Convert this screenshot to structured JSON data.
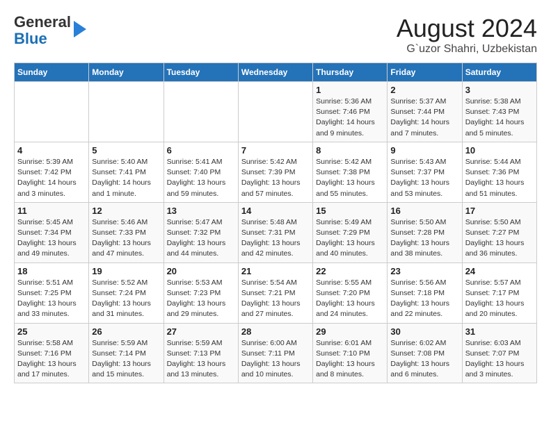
{
  "header": {
    "logo_line1": "General",
    "logo_line2": "Blue",
    "title": "August 2024",
    "subtitle": "G`uzor Shahri, Uzbekistan"
  },
  "days_of_week": [
    "Sunday",
    "Monday",
    "Tuesday",
    "Wednesday",
    "Thursday",
    "Friday",
    "Saturday"
  ],
  "weeks": [
    [
      {
        "day": "",
        "info": ""
      },
      {
        "day": "",
        "info": ""
      },
      {
        "day": "",
        "info": ""
      },
      {
        "day": "",
        "info": ""
      },
      {
        "day": "1",
        "info": "Sunrise: 5:36 AM\nSunset: 7:46 PM\nDaylight: 14 hours\nand 9 minutes."
      },
      {
        "day": "2",
        "info": "Sunrise: 5:37 AM\nSunset: 7:44 PM\nDaylight: 14 hours\nand 7 minutes."
      },
      {
        "day": "3",
        "info": "Sunrise: 5:38 AM\nSunset: 7:43 PM\nDaylight: 14 hours\nand 5 minutes."
      }
    ],
    [
      {
        "day": "4",
        "info": "Sunrise: 5:39 AM\nSunset: 7:42 PM\nDaylight: 14 hours\nand 3 minutes."
      },
      {
        "day": "5",
        "info": "Sunrise: 5:40 AM\nSunset: 7:41 PM\nDaylight: 14 hours\nand 1 minute."
      },
      {
        "day": "6",
        "info": "Sunrise: 5:41 AM\nSunset: 7:40 PM\nDaylight: 13 hours\nand 59 minutes."
      },
      {
        "day": "7",
        "info": "Sunrise: 5:42 AM\nSunset: 7:39 PM\nDaylight: 13 hours\nand 57 minutes."
      },
      {
        "day": "8",
        "info": "Sunrise: 5:42 AM\nSunset: 7:38 PM\nDaylight: 13 hours\nand 55 minutes."
      },
      {
        "day": "9",
        "info": "Sunrise: 5:43 AM\nSunset: 7:37 PM\nDaylight: 13 hours\nand 53 minutes."
      },
      {
        "day": "10",
        "info": "Sunrise: 5:44 AM\nSunset: 7:36 PM\nDaylight: 13 hours\nand 51 minutes."
      }
    ],
    [
      {
        "day": "11",
        "info": "Sunrise: 5:45 AM\nSunset: 7:34 PM\nDaylight: 13 hours\nand 49 minutes."
      },
      {
        "day": "12",
        "info": "Sunrise: 5:46 AM\nSunset: 7:33 PM\nDaylight: 13 hours\nand 47 minutes."
      },
      {
        "day": "13",
        "info": "Sunrise: 5:47 AM\nSunset: 7:32 PM\nDaylight: 13 hours\nand 44 minutes."
      },
      {
        "day": "14",
        "info": "Sunrise: 5:48 AM\nSunset: 7:31 PM\nDaylight: 13 hours\nand 42 minutes."
      },
      {
        "day": "15",
        "info": "Sunrise: 5:49 AM\nSunset: 7:29 PM\nDaylight: 13 hours\nand 40 minutes."
      },
      {
        "day": "16",
        "info": "Sunrise: 5:50 AM\nSunset: 7:28 PM\nDaylight: 13 hours\nand 38 minutes."
      },
      {
        "day": "17",
        "info": "Sunrise: 5:50 AM\nSunset: 7:27 PM\nDaylight: 13 hours\nand 36 minutes."
      }
    ],
    [
      {
        "day": "18",
        "info": "Sunrise: 5:51 AM\nSunset: 7:25 PM\nDaylight: 13 hours\nand 33 minutes."
      },
      {
        "day": "19",
        "info": "Sunrise: 5:52 AM\nSunset: 7:24 PM\nDaylight: 13 hours\nand 31 minutes."
      },
      {
        "day": "20",
        "info": "Sunrise: 5:53 AM\nSunset: 7:23 PM\nDaylight: 13 hours\nand 29 minutes."
      },
      {
        "day": "21",
        "info": "Sunrise: 5:54 AM\nSunset: 7:21 PM\nDaylight: 13 hours\nand 27 minutes."
      },
      {
        "day": "22",
        "info": "Sunrise: 5:55 AM\nSunset: 7:20 PM\nDaylight: 13 hours\nand 24 minutes."
      },
      {
        "day": "23",
        "info": "Sunrise: 5:56 AM\nSunset: 7:18 PM\nDaylight: 13 hours\nand 22 minutes."
      },
      {
        "day": "24",
        "info": "Sunrise: 5:57 AM\nSunset: 7:17 PM\nDaylight: 13 hours\nand 20 minutes."
      }
    ],
    [
      {
        "day": "25",
        "info": "Sunrise: 5:58 AM\nSunset: 7:16 PM\nDaylight: 13 hours\nand 17 minutes."
      },
      {
        "day": "26",
        "info": "Sunrise: 5:59 AM\nSunset: 7:14 PM\nDaylight: 13 hours\nand 15 minutes."
      },
      {
        "day": "27",
        "info": "Sunrise: 5:59 AM\nSunset: 7:13 PM\nDaylight: 13 hours\nand 13 minutes."
      },
      {
        "day": "28",
        "info": "Sunrise: 6:00 AM\nSunset: 7:11 PM\nDaylight: 13 hours\nand 10 minutes."
      },
      {
        "day": "29",
        "info": "Sunrise: 6:01 AM\nSunset: 7:10 PM\nDaylight: 13 hours\nand 8 minutes."
      },
      {
        "day": "30",
        "info": "Sunrise: 6:02 AM\nSunset: 7:08 PM\nDaylight: 13 hours\nand 6 minutes."
      },
      {
        "day": "31",
        "info": "Sunrise: 6:03 AM\nSunset: 7:07 PM\nDaylight: 13 hours\nand 3 minutes."
      }
    ]
  ]
}
